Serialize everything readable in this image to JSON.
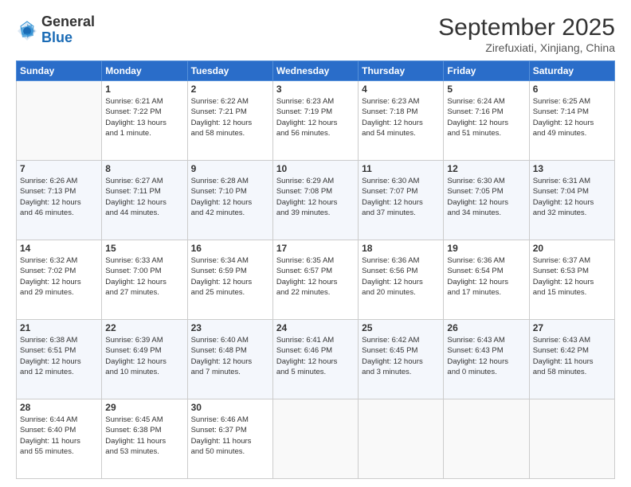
{
  "logo": {
    "general": "General",
    "blue": "Blue"
  },
  "title": "September 2025",
  "location": "Zirefuxiati, Xinjiang, China",
  "weekdays": [
    "Sunday",
    "Monday",
    "Tuesday",
    "Wednesday",
    "Thursday",
    "Friday",
    "Saturday"
  ],
  "weeks": [
    [
      {
        "day": "",
        "info": ""
      },
      {
        "day": "1",
        "info": "Sunrise: 6:21 AM\nSunset: 7:22 PM\nDaylight: 13 hours\nand 1 minute."
      },
      {
        "day": "2",
        "info": "Sunrise: 6:22 AM\nSunset: 7:21 PM\nDaylight: 12 hours\nand 58 minutes."
      },
      {
        "day": "3",
        "info": "Sunrise: 6:23 AM\nSunset: 7:19 PM\nDaylight: 12 hours\nand 56 minutes."
      },
      {
        "day": "4",
        "info": "Sunrise: 6:23 AM\nSunset: 7:18 PM\nDaylight: 12 hours\nand 54 minutes."
      },
      {
        "day": "5",
        "info": "Sunrise: 6:24 AM\nSunset: 7:16 PM\nDaylight: 12 hours\nand 51 minutes."
      },
      {
        "day": "6",
        "info": "Sunrise: 6:25 AM\nSunset: 7:14 PM\nDaylight: 12 hours\nand 49 minutes."
      }
    ],
    [
      {
        "day": "7",
        "info": "Sunrise: 6:26 AM\nSunset: 7:13 PM\nDaylight: 12 hours\nand 46 minutes."
      },
      {
        "day": "8",
        "info": "Sunrise: 6:27 AM\nSunset: 7:11 PM\nDaylight: 12 hours\nand 44 minutes."
      },
      {
        "day": "9",
        "info": "Sunrise: 6:28 AM\nSunset: 7:10 PM\nDaylight: 12 hours\nand 42 minutes."
      },
      {
        "day": "10",
        "info": "Sunrise: 6:29 AM\nSunset: 7:08 PM\nDaylight: 12 hours\nand 39 minutes."
      },
      {
        "day": "11",
        "info": "Sunrise: 6:30 AM\nSunset: 7:07 PM\nDaylight: 12 hours\nand 37 minutes."
      },
      {
        "day": "12",
        "info": "Sunrise: 6:30 AM\nSunset: 7:05 PM\nDaylight: 12 hours\nand 34 minutes."
      },
      {
        "day": "13",
        "info": "Sunrise: 6:31 AM\nSunset: 7:04 PM\nDaylight: 12 hours\nand 32 minutes."
      }
    ],
    [
      {
        "day": "14",
        "info": "Sunrise: 6:32 AM\nSunset: 7:02 PM\nDaylight: 12 hours\nand 29 minutes."
      },
      {
        "day": "15",
        "info": "Sunrise: 6:33 AM\nSunset: 7:00 PM\nDaylight: 12 hours\nand 27 minutes."
      },
      {
        "day": "16",
        "info": "Sunrise: 6:34 AM\nSunset: 6:59 PM\nDaylight: 12 hours\nand 25 minutes."
      },
      {
        "day": "17",
        "info": "Sunrise: 6:35 AM\nSunset: 6:57 PM\nDaylight: 12 hours\nand 22 minutes."
      },
      {
        "day": "18",
        "info": "Sunrise: 6:36 AM\nSunset: 6:56 PM\nDaylight: 12 hours\nand 20 minutes."
      },
      {
        "day": "19",
        "info": "Sunrise: 6:36 AM\nSunset: 6:54 PM\nDaylight: 12 hours\nand 17 minutes."
      },
      {
        "day": "20",
        "info": "Sunrise: 6:37 AM\nSunset: 6:53 PM\nDaylight: 12 hours\nand 15 minutes."
      }
    ],
    [
      {
        "day": "21",
        "info": "Sunrise: 6:38 AM\nSunset: 6:51 PM\nDaylight: 12 hours\nand 12 minutes."
      },
      {
        "day": "22",
        "info": "Sunrise: 6:39 AM\nSunset: 6:49 PM\nDaylight: 12 hours\nand 10 minutes."
      },
      {
        "day": "23",
        "info": "Sunrise: 6:40 AM\nSunset: 6:48 PM\nDaylight: 12 hours\nand 7 minutes."
      },
      {
        "day": "24",
        "info": "Sunrise: 6:41 AM\nSunset: 6:46 PM\nDaylight: 12 hours\nand 5 minutes."
      },
      {
        "day": "25",
        "info": "Sunrise: 6:42 AM\nSunset: 6:45 PM\nDaylight: 12 hours\nand 3 minutes."
      },
      {
        "day": "26",
        "info": "Sunrise: 6:43 AM\nSunset: 6:43 PM\nDaylight: 12 hours\nand 0 minutes."
      },
      {
        "day": "27",
        "info": "Sunrise: 6:43 AM\nSunset: 6:42 PM\nDaylight: 11 hours\nand 58 minutes."
      }
    ],
    [
      {
        "day": "28",
        "info": "Sunrise: 6:44 AM\nSunset: 6:40 PM\nDaylight: 11 hours\nand 55 minutes."
      },
      {
        "day": "29",
        "info": "Sunrise: 6:45 AM\nSunset: 6:38 PM\nDaylight: 11 hours\nand 53 minutes."
      },
      {
        "day": "30",
        "info": "Sunrise: 6:46 AM\nSunset: 6:37 PM\nDaylight: 11 hours\nand 50 minutes."
      },
      {
        "day": "",
        "info": ""
      },
      {
        "day": "",
        "info": ""
      },
      {
        "day": "",
        "info": ""
      },
      {
        "day": "",
        "info": ""
      }
    ]
  ]
}
